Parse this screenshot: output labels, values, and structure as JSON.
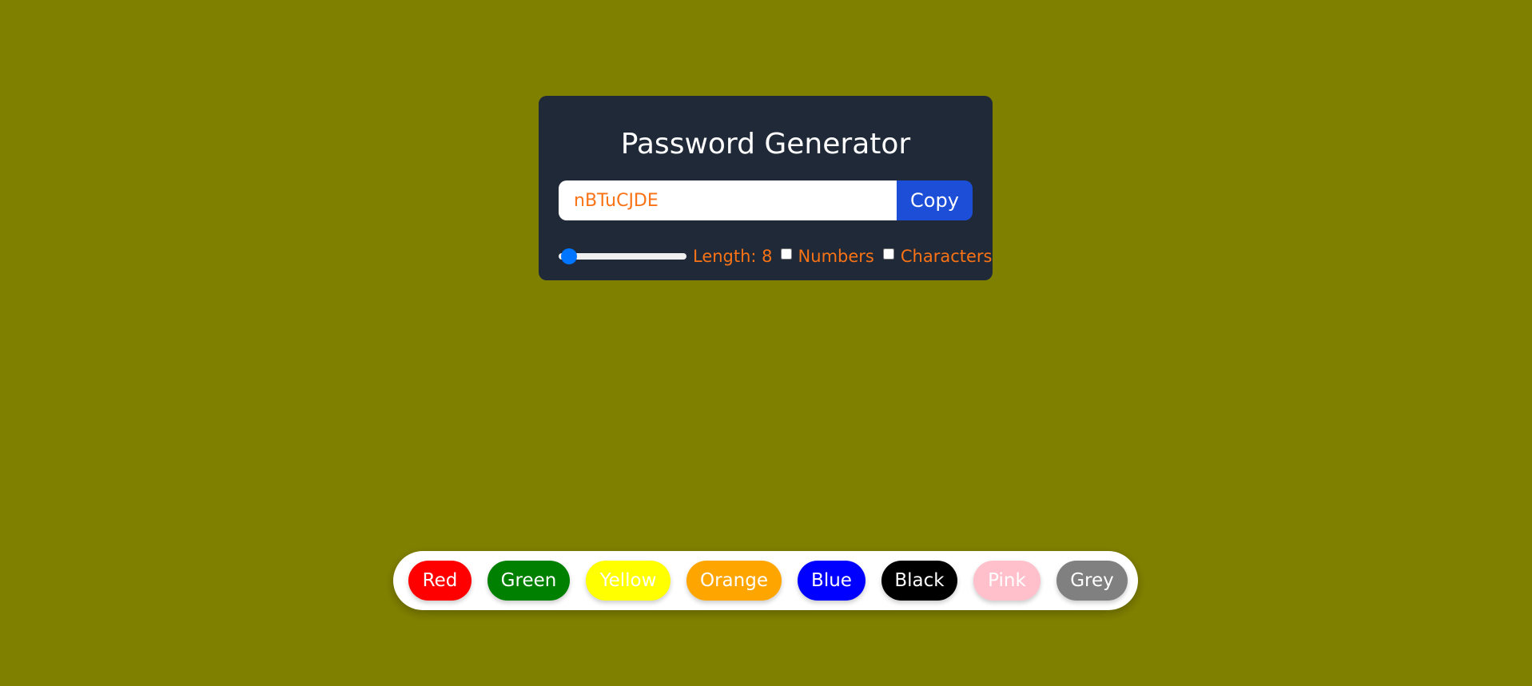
{
  "app": {
    "title": "Password Generator"
  },
  "password": {
    "value": "nBTuCJDE",
    "copy_label": "Copy"
  },
  "options": {
    "length_value": 8,
    "length_label": "Length: 8",
    "numbers_label": "Numbers",
    "numbers_checked": false,
    "characters_label": "Characters",
    "characters_checked": false
  },
  "colors": {
    "page_background": "#808000",
    "card_background": "#1f2937",
    "accent_text": "#f97316",
    "copy_button": "#1d4ed8",
    "slider_thumb": "#0075ff"
  },
  "palette": [
    {
      "label": "Red",
      "color": "#ff0000"
    },
    {
      "label": "Green",
      "color": "#008000"
    },
    {
      "label": "Yellow",
      "color": "#ffff00"
    },
    {
      "label": "Orange",
      "color": "#ffa500"
    },
    {
      "label": "Blue",
      "color": "#0000ff"
    },
    {
      "label": "Black",
      "color": "#000000"
    },
    {
      "label": "Pink",
      "color": "#ffc0cb"
    },
    {
      "label": "Grey",
      "color": "#808080"
    }
  ]
}
